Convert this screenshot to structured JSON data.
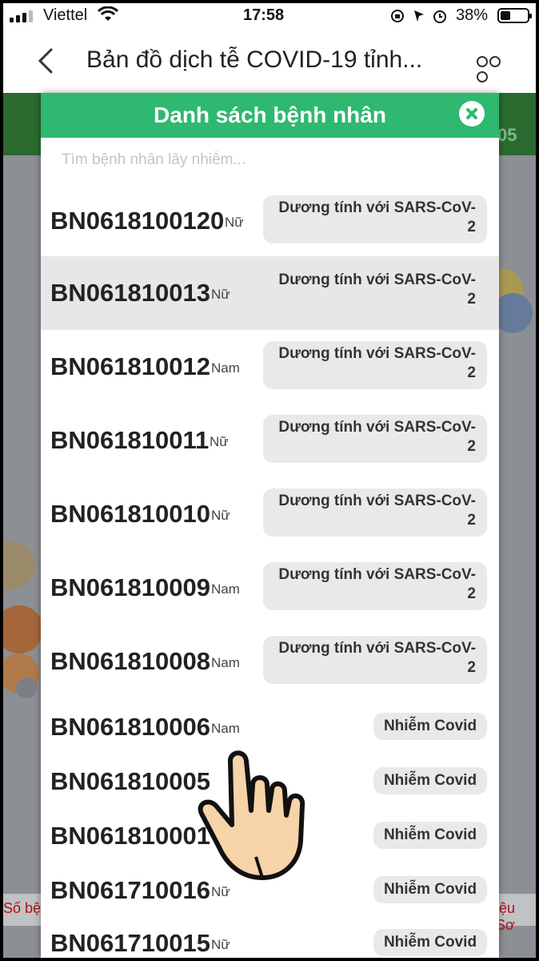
{
  "status_bar": {
    "carrier": "Viettel",
    "time": "17:58",
    "battery": "38%"
  },
  "nav": {
    "title": "Bản đồ dịch tễ COVID-19 tỉnh..."
  },
  "background": {
    "footer_left": "Số bện",
    "footer_right": "iệu Sơ",
    "header_right_frag": "05"
  },
  "modal": {
    "title": "Danh sách bệnh nhân",
    "search_placeholder": "Tìm bệnh nhân lây nhiễm...",
    "patients": [
      {
        "id": "BN0618100120",
        "gender": "Nữ",
        "status": "Dương tính với SARS-CoV-2",
        "selected": false
      },
      {
        "id": "BN061810013",
        "gender": "Nữ",
        "status": "Dương tính với SARS-CoV-2",
        "selected": true
      },
      {
        "id": "BN061810012",
        "gender": "Nam",
        "status": "Dương tính với SARS-CoV-2",
        "selected": false
      },
      {
        "id": "BN061810011",
        "gender": "Nữ",
        "status": "Dương tính với SARS-CoV-2",
        "selected": false
      },
      {
        "id": "BN061810010",
        "gender": "Nữ",
        "status": "Dương tính với SARS-CoV-2",
        "selected": false
      },
      {
        "id": "BN061810009",
        "gender": "Nam",
        "status": "Dương tính với SARS-CoV-2",
        "selected": false
      },
      {
        "id": "BN061810008",
        "gender": "Nam",
        "status": "Dương tính với SARS-CoV-2",
        "selected": false
      },
      {
        "id": "BN061810006",
        "gender": "Nam",
        "status": "Nhiễm Covid",
        "selected": false
      },
      {
        "id": "BN061810005",
        "gender": "",
        "status": "Nhiễm Covid",
        "selected": false
      },
      {
        "id": "BN061810001",
        "gender": "",
        "status": "Nhiễm Covid",
        "selected": false
      },
      {
        "id": "BN061710016",
        "gender": "Nữ",
        "status": "Nhiễm Covid",
        "selected": false
      },
      {
        "id": "BN061710015",
        "gender": "Nữ",
        "status": "Nhiễm Covid",
        "selected": false
      }
    ]
  },
  "colors": {
    "header_green": "#2eb870",
    "selected_row": "#e7e7e7",
    "badge_bg": "#e9e9e9"
  },
  "icons": [
    "signal-icon",
    "wifi-icon",
    "rotation-lock-icon",
    "location-icon",
    "alarm-icon",
    "battery-icon",
    "back-chevron-icon",
    "more-options-icon",
    "close-icon",
    "hand-pointer-icon"
  ]
}
